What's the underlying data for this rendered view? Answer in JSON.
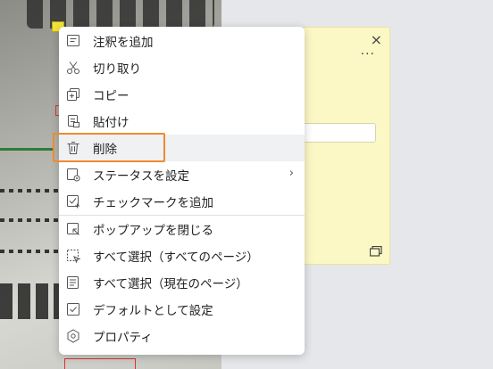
{
  "menu": {
    "items": [
      {
        "label": "注釈を追加",
        "icon": "add-comment-icon"
      },
      {
        "label": "切り取り",
        "icon": "scissors-icon"
      },
      {
        "label": "コピー",
        "icon": "copy-icon"
      },
      {
        "label": "貼付け",
        "icon": "paste-icon"
      },
      {
        "label": "削除",
        "icon": "trash-icon"
      },
      {
        "label": "ステータスを設定",
        "icon": "status-icon",
        "submenu": "›"
      },
      {
        "label": "チェックマークを追加",
        "icon": "checkmark-add-icon"
      },
      {
        "label": "ポップアップを閉じる",
        "icon": "close-popup-icon"
      },
      {
        "label": "すべて選択（すべてのページ）",
        "icon": "select-all-pages-icon"
      },
      {
        "label": "すべて選択（現在のページ）",
        "icon": "select-current-page-icon"
      },
      {
        "label": "デフォルトとして設定",
        "icon": "checkbox-icon"
      },
      {
        "label": "プロパティ",
        "icon": "properties-icon"
      }
    ]
  },
  "sticky_note": {
    "close_glyph": "×",
    "more_glyph": "···"
  },
  "colors": {
    "highlight_border": "#f08a2c",
    "note_background": "#fcf8c5",
    "hover_background": "#f0f1f3"
  }
}
